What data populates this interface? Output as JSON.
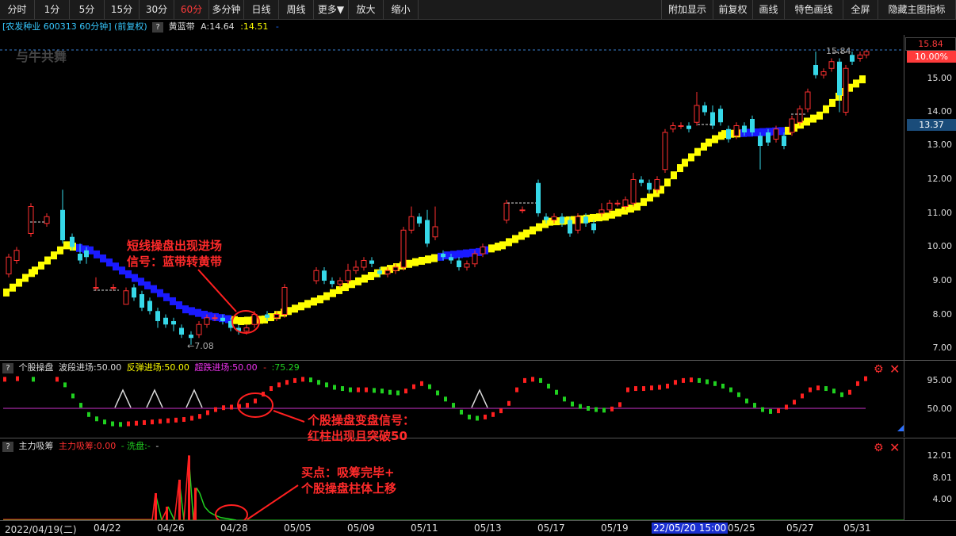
{
  "toolbar": {
    "left": [
      "分时",
      "1分",
      "5分",
      "15分",
      "30分",
      "60分",
      "多分钟",
      "日线",
      "周线",
      "更多▼",
      "放大",
      "缩小"
    ],
    "right": [
      "附加显示",
      "前复权",
      "画线",
      "特色画线",
      "全屏",
      "隐藏主图指标"
    ],
    "active": "60分"
  },
  "info": {
    "stock": "[农发种业 600313 60分钟] (前复权)",
    "qm": "?",
    "indicator": "黄蓝带",
    "a_value": "A:14.64",
    "yellow_value": ":14.51",
    "dash": "-"
  },
  "watermark": "与牛共舞",
  "price_axis": {
    "ticks": [
      "15.00",
      "14.00",
      "13.00",
      "12.00",
      "11.00",
      "10.00",
      "9.00",
      "8.00",
      "7.00"
    ],
    "top_price": "15.84",
    "top_pct": "10.00%",
    "current": "13.37"
  },
  "chart_labels": {
    "high": "15.84",
    "low": "←7.08"
  },
  "sub1": {
    "name": "个股操盘",
    "wave": "波段进场:50.00",
    "rebound": "反弹进场:50.00",
    "oversold": "超跌进场:50.00",
    "dash": "-",
    "value": ":75.29",
    "ticks": [
      "95.00",
      "50.00"
    ],
    "colors": {
      "up": "#ff2020",
      "down": "#20d020",
      "line": "#cc33cc"
    }
  },
  "sub2": {
    "name": "主力吸筹",
    "absorb": "主力吸筹:0.00",
    "wash": "- 洗盘:-",
    "tail": "-",
    "ticks": [
      "12.01",
      "8.01",
      "4.00"
    ]
  },
  "dates": [
    "2022/04/19(二)",
    "04/22",
    "04/26",
    "04/28",
    "05/05",
    "05/09",
    "05/11",
    "05/13",
    "05/17",
    "05/19",
    "22/05/20 15:00",
    "05/25",
    "05/27",
    "05/31"
  ],
  "annotations": {
    "a1_line1": "短线操盘出现进场",
    "a1_line2": "信号：蓝带转黄带",
    "a2_line1": "个股操盘变盘信号：",
    "a2_line2": "红柱出现且突破50",
    "a3_line1": "买点：吸筹完毕+",
    "a3_line2": "个股操盘柱体上移"
  },
  "colors": {
    "yellow_band": "#ffff00",
    "blue_band": "#1a1aff",
    "candle_up": "#ff3030",
    "candle_down": "#36d8e8",
    "accent": "#ff3b3b"
  }
}
